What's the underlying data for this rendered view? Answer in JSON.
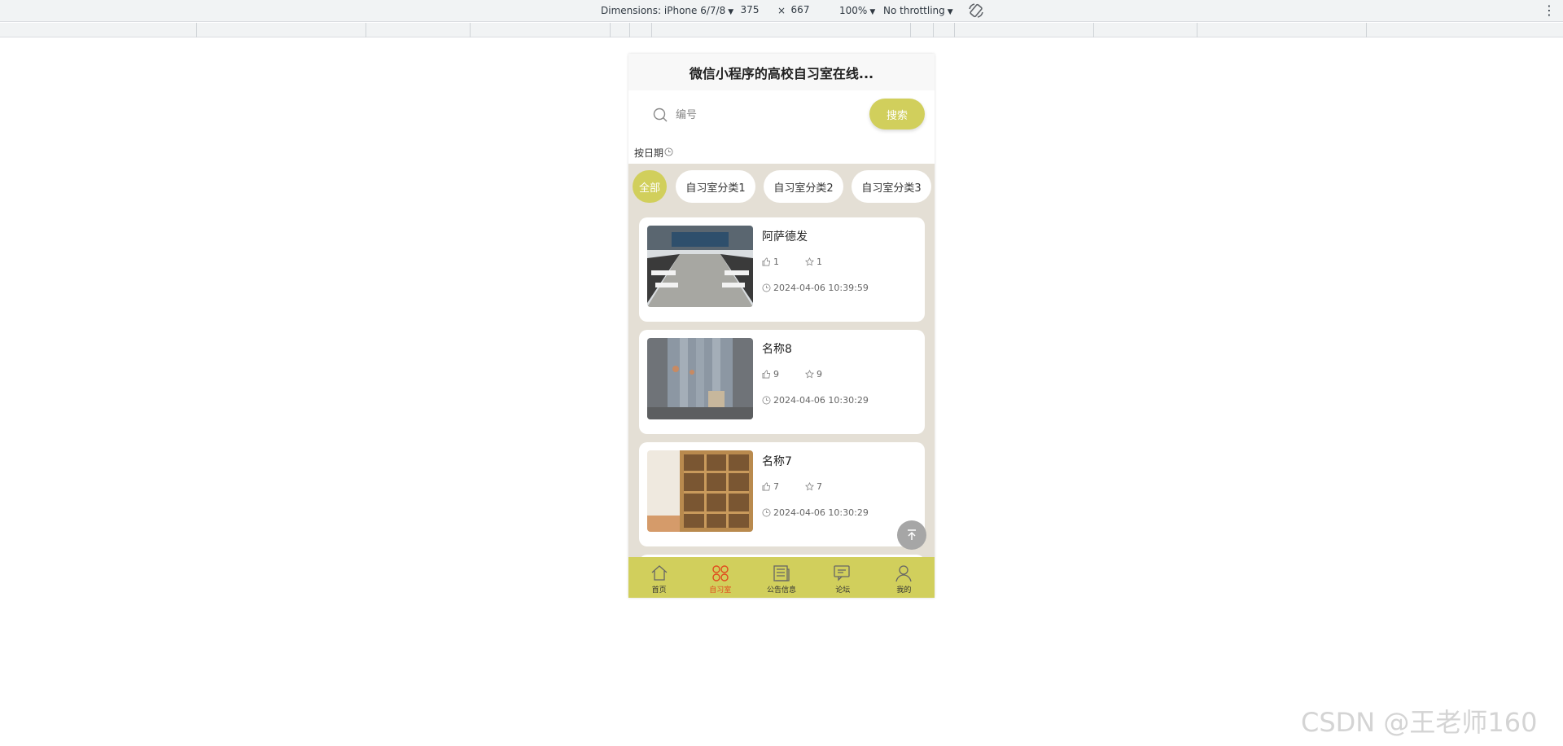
{
  "devtools": {
    "dimensions_label": "Dimensions: iPhone 6/7/8",
    "width": "375",
    "times": "×",
    "height": "667",
    "zoom": "100%",
    "throttling": "No throttling",
    "icons": {
      "rotate": "rotate-icon",
      "menu": "more-vert-icon"
    }
  },
  "app": {
    "title": "微信小程序的高校自习室在线...",
    "search": {
      "placeholder": "编号",
      "button": "搜索"
    },
    "sort_label": "按日期",
    "tabs": [
      "全部",
      "自习室分类1",
      "自习室分类2",
      "自习室分类3"
    ],
    "active_tab": "全部",
    "items": [
      {
        "name": "阿萨德发",
        "likes": "1",
        "favorites": "1",
        "time": "2024-04-06 10:39:59"
      },
      {
        "name": "名称8",
        "likes": "9",
        "favorites": "9",
        "time": "2024-04-06 10:30:29"
      },
      {
        "name": "名称7",
        "likes": "7",
        "favorites": "7",
        "time": "2024-04-06 10:30:29"
      }
    ],
    "tabbar": [
      {
        "label": "首页",
        "icon": "home-icon"
      },
      {
        "label": "自习室",
        "icon": "clover-icon"
      },
      {
        "label": "公告信息",
        "icon": "newspaper-icon"
      },
      {
        "label": "论坛",
        "icon": "chat-icon"
      },
      {
        "label": "我的",
        "icon": "user-icon"
      }
    ],
    "active_tabbar": "自习室"
  },
  "colors": {
    "accent": "#d1cf5c",
    "page_bg": "#e4dfd5",
    "active_icon": "#e14b1e"
  },
  "watermark": "CSDN @王老师160"
}
